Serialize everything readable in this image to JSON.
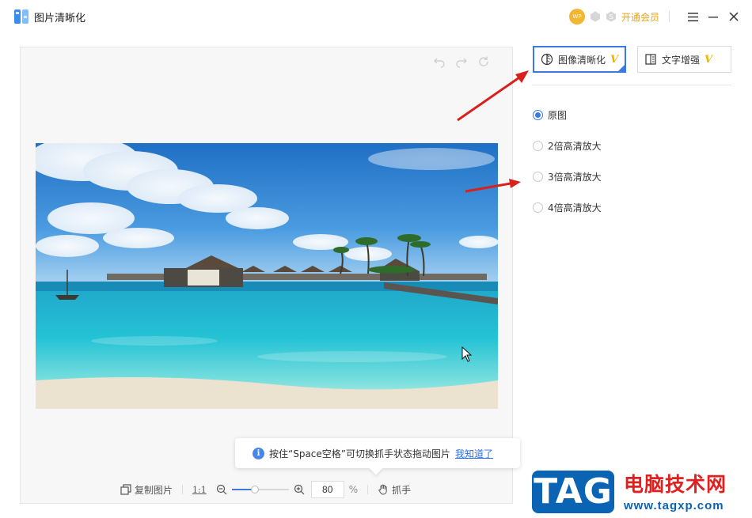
{
  "app": {
    "title": "图片清晰化",
    "avatar_text": "WP",
    "vip_label": "开通会员"
  },
  "tip": {
    "text": "按住“Space空格”可切换抓手状态拖动图片",
    "link": "我知道了",
    "icon": "info-icon"
  },
  "toolbar": {
    "copy_label": "复制图片",
    "ratio_label": "1:1",
    "zoom_value": "80",
    "zoom_unit": "%",
    "zoom_fraction": 0.4,
    "hand_label": "抓手"
  },
  "modes": [
    {
      "label": "图像清晰化",
      "badge": "V",
      "active": true
    },
    {
      "label": "文字增强",
      "badge": "V",
      "active": false
    }
  ],
  "options": [
    {
      "label": "原图",
      "checked": true
    },
    {
      "label": "2倍高清放大",
      "checked": false
    },
    {
      "label": "3倍高清放大",
      "checked": false
    },
    {
      "label": "4倍高清放大",
      "checked": false
    }
  ],
  "watermark": {
    "tag": "TAG",
    "name": "电脑技术网",
    "url": "www.tagxp.com"
  },
  "colors": {
    "accent": "#3b7ae0",
    "vip": "#e8a317",
    "arrow": "#d9201c"
  }
}
